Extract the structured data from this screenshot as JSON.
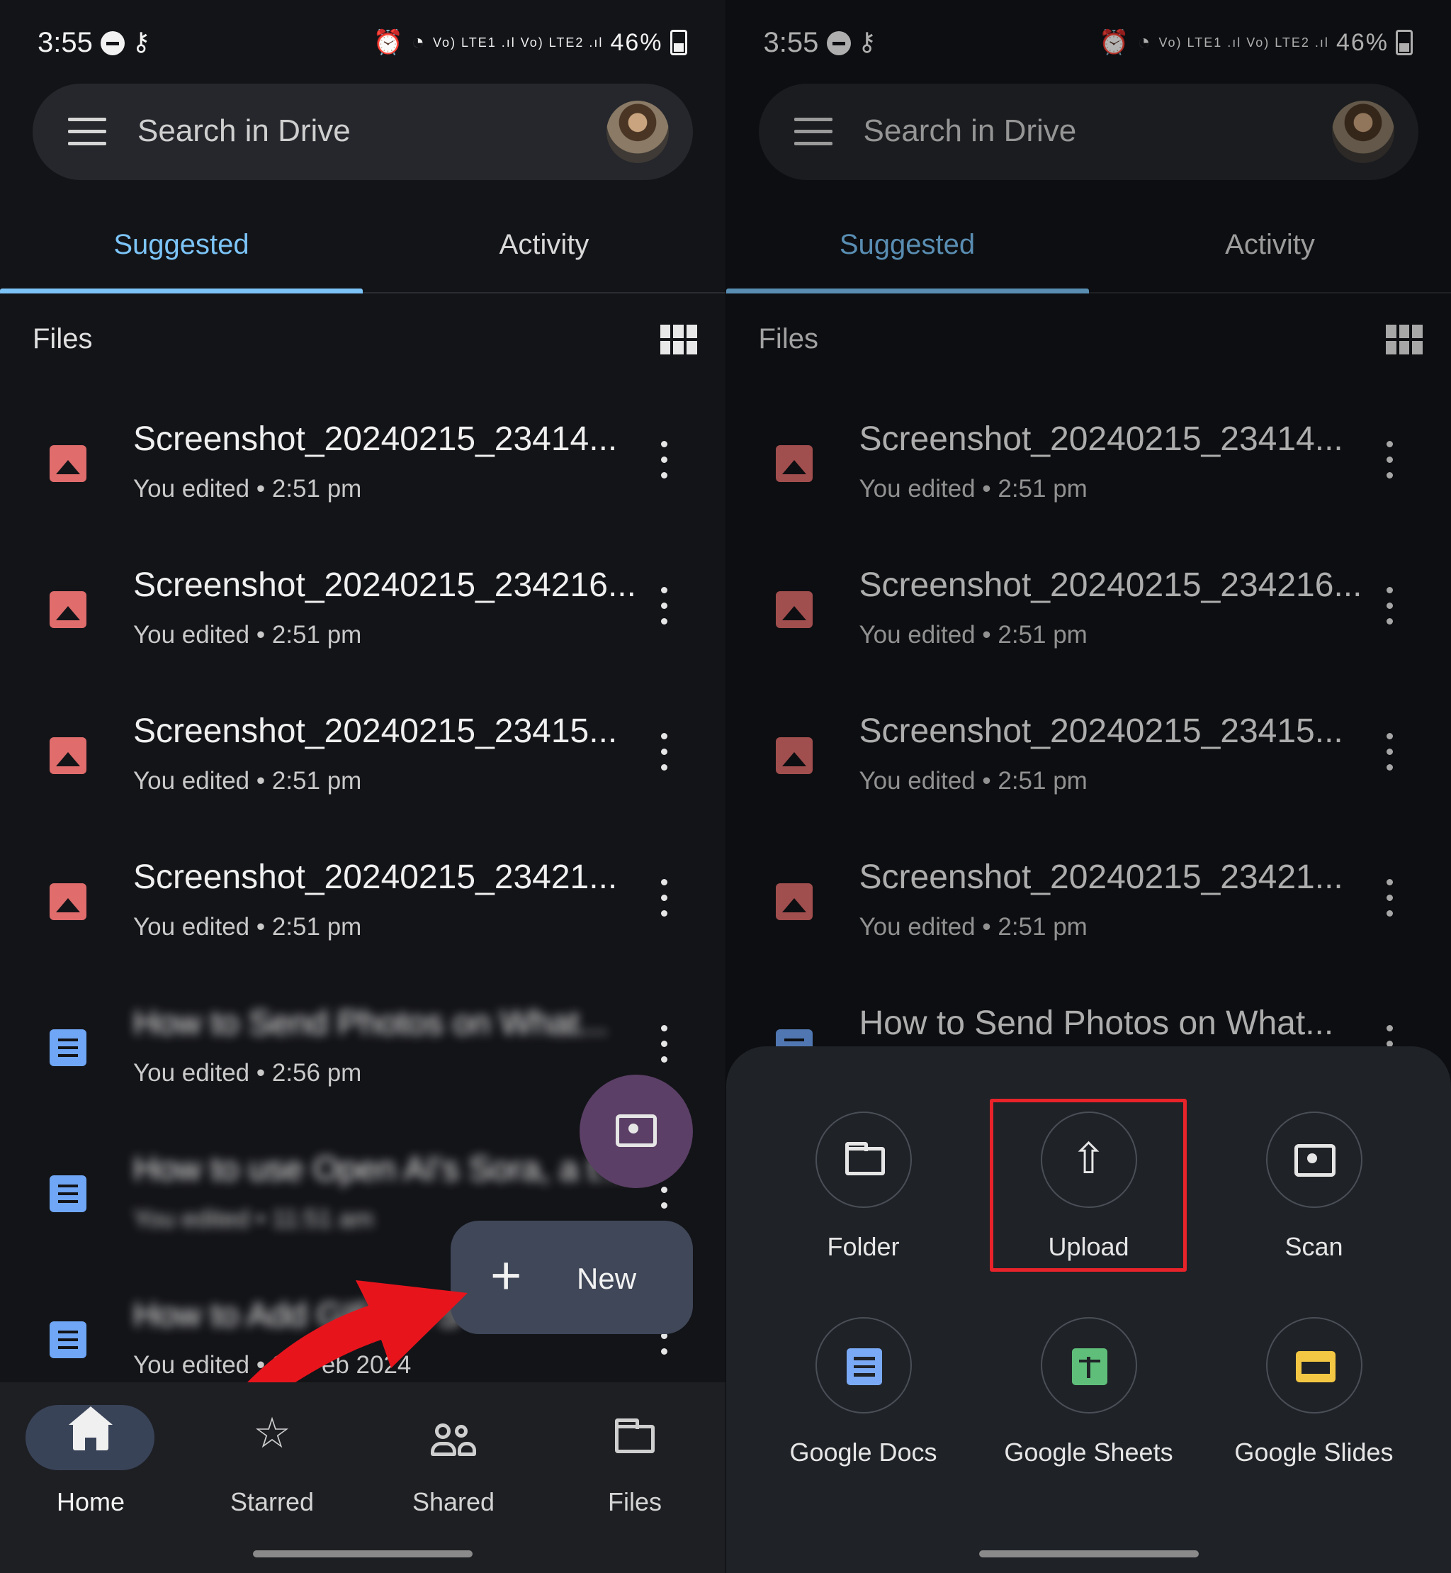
{
  "status_bar": {
    "time": "3:55",
    "battery": "46%",
    "network": "Vo) LTE1 .ıl Vo) LTE2 .ıl"
  },
  "search": {
    "placeholder": "Search in Drive"
  },
  "tabs": [
    {
      "label": "Suggested",
      "active": true
    },
    {
      "label": "Activity",
      "active": false
    }
  ],
  "files_header": "Files",
  "files": [
    {
      "name": "Screenshot_20240215_23414...",
      "meta": "You edited • 2:51 pm",
      "type": "image",
      "blurred": false
    },
    {
      "name": "Screenshot_20240215_234216...",
      "meta": "You edited • 2:51 pm",
      "type": "image",
      "blurred": false
    },
    {
      "name": "Screenshot_20240215_23415...",
      "meta": "You edited • 2:51 pm",
      "type": "image",
      "blurred": false
    },
    {
      "name": "Screenshot_20240215_23421...",
      "meta": "You edited • 2:51 pm",
      "type": "image",
      "blurred": false
    },
    {
      "name": "How to Send Photos on What...",
      "meta": "You edited • 2:56 pm",
      "type": "doc",
      "blurred": true
    },
    {
      "name": "How to use Open AI's Sora, a t...",
      "meta": "You edited • 11:51 am",
      "type": "doc",
      "blurred": true
    },
    {
      "name": "How to Add GIFs to S",
      "meta": "You edited • 21 Feb 2024",
      "type": "doc",
      "blurred": true
    }
  ],
  "fab": {
    "new_label": "New",
    "plus": "+"
  },
  "bottom_nav": [
    {
      "label": "Home",
      "icon": "home-icon",
      "active": true
    },
    {
      "label": "Starred",
      "icon": "star-icon",
      "active": false
    },
    {
      "label": "Shared",
      "icon": "people-icon",
      "active": false
    },
    {
      "label": "Files",
      "icon": "folder-icon",
      "active": false
    }
  ],
  "right_visible_doc": {
    "name": "How to Send Photos on What..."
  },
  "create_sheet": {
    "options": [
      {
        "label": "Folder",
        "icon": "folder-icon"
      },
      {
        "label": "Upload",
        "icon": "upload-icon",
        "highlighted": true
      },
      {
        "label": "Scan",
        "icon": "camera-icon"
      },
      {
        "label": "Google Docs",
        "icon": "docs-icon"
      },
      {
        "label": "Google Sheets",
        "icon": "sheets-icon"
      },
      {
        "label": "Google Slides",
        "icon": "slides-icon"
      }
    ]
  },
  "colors": {
    "background": "#131418",
    "accent": "#7cc4f7",
    "image_icon": "#e06c6c",
    "doc_icon": "#6fa6f5",
    "highlight": "#e8232a",
    "arrow": "#e8141c"
  }
}
